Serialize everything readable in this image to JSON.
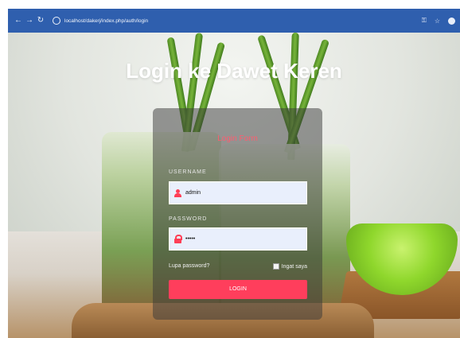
{
  "browser": {
    "url": "localhost/dakerj/index.php/auth/login",
    "right_icons": [
      "key-icon",
      "star-icon",
      "profile-icon"
    ]
  },
  "page": {
    "title": "Login ke Dawet Keren"
  },
  "login": {
    "title": "Login Form",
    "username_label": "USERNAME",
    "username_value": "admin",
    "password_label": "PASSWORD",
    "password_value": "•••••",
    "forgot_password": "Lupa password?",
    "remember_me": "Ingat saya",
    "button_label": "LOGIN"
  },
  "colors": {
    "browser_bar": "#2f5fae",
    "accent": "#ff3e5c",
    "panel_bg": "rgba(55,55,55,0.5)"
  }
}
